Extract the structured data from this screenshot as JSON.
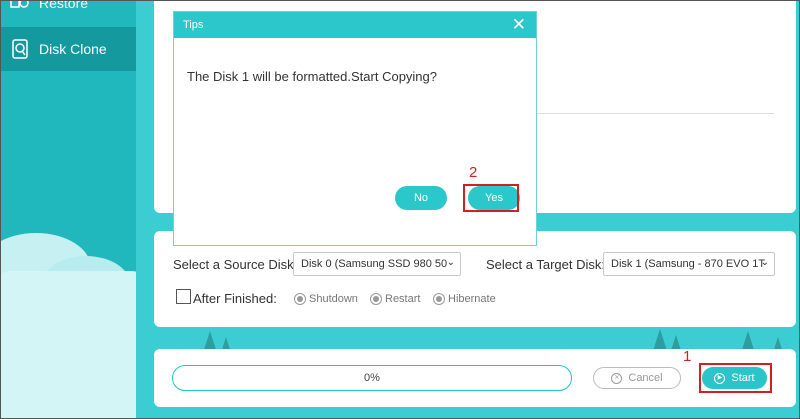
{
  "sidebar": {
    "items": [
      {
        "label": "Restore",
        "icon": "restore-icon"
      },
      {
        "label": "Disk Clone",
        "icon": "disk-clone-icon",
        "active": true
      }
    ]
  },
  "dialog": {
    "title": "Tips",
    "message": "The Disk 1 will be formatted.Start Copying?",
    "no_label": "No",
    "yes_label": "Yes",
    "step_marker": "2"
  },
  "settings": {
    "source_label": "Select a Source Disk:",
    "source_value": "Disk 0  (Samsung SSD 980 50",
    "target_label": "Select a Target Disk:",
    "target_value": "Disk 1 (Samsung - 870 EVO 1T",
    "after_finished_label": "After Finished:",
    "after_finished_checked": false,
    "options": [
      "Shutdown",
      "Restart",
      "Hibernate"
    ]
  },
  "actions": {
    "progress_text": "0%",
    "progress": 0,
    "cancel_label": "Cancel",
    "start_label": "Start",
    "step_marker": "1"
  },
  "colors": {
    "accent": "#2bc7cb",
    "sidebar": "#20b8bc",
    "sidebar_active": "#149a9e",
    "highlight": "#d21f1f"
  }
}
